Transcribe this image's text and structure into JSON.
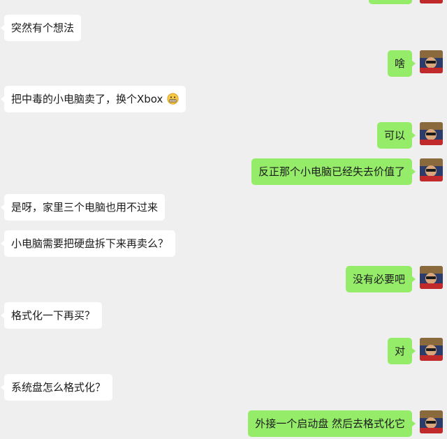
{
  "messages": [
    {
      "side": "left",
      "text": "突然有个想法"
    },
    {
      "side": "right",
      "text": "啥"
    },
    {
      "side": "left",
      "text": "把中毒的小电脑卖了，换个Xbox",
      "emoji": "grimacing-face-emoji"
    },
    {
      "side": "right",
      "text": "可以"
    },
    {
      "side": "right",
      "text": "反正那个小电脑已经失去价值了"
    },
    {
      "side": "left",
      "text": "是呀，家里三个电脑也用不过来"
    },
    {
      "side": "left",
      "text": "小电脑需要把硬盘拆下来再卖么？"
    },
    {
      "side": "right",
      "text": "没有必要吧"
    },
    {
      "side": "left",
      "text": "格式化一下再买？"
    },
    {
      "side": "right",
      "text": "对"
    },
    {
      "side": "left",
      "text": "系统盘怎么格式化？"
    },
    {
      "side": "right",
      "text": "外接一个启动盘 然后去格式化它"
    }
  ],
  "colors": {
    "background": "#efefef",
    "sent_bubble": "#95ec69",
    "received_bubble": "#ffffff"
  },
  "avatar": {
    "icon": "user-avatar-photo"
  }
}
